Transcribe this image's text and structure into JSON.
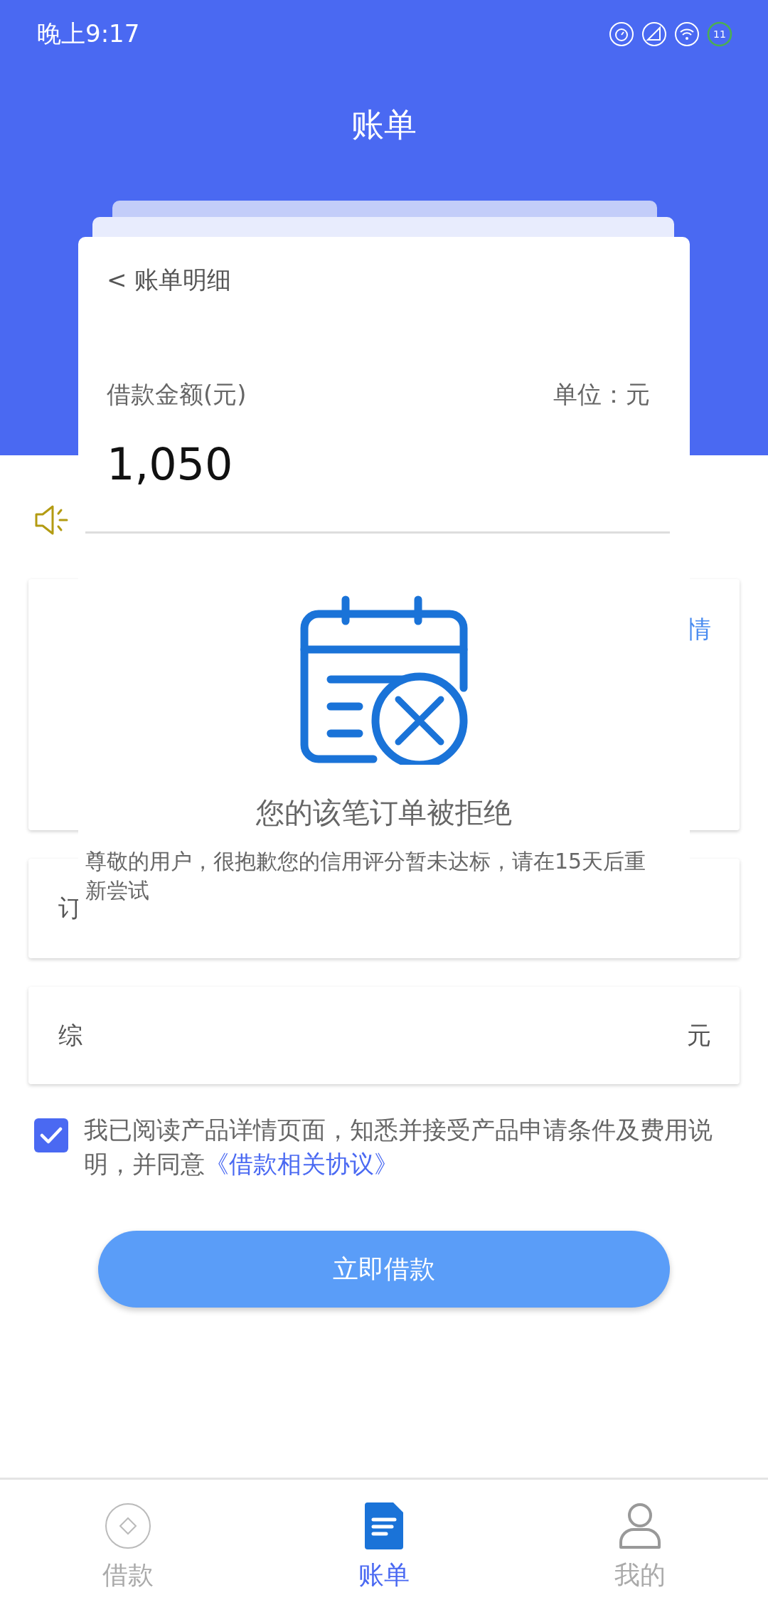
{
  "status_bar": {
    "time": "晚上9:17",
    "battery": "11"
  },
  "header": {
    "title": "账单"
  },
  "background_cards": [
    {
      "right": "情"
    },
    {
      "left": "订"
    },
    {
      "left": "综",
      "right": "元"
    }
  ],
  "dialog": {
    "back": "< 账单明细",
    "amount_label": "借款金额(元)",
    "unit": "单位：元",
    "amount": "1,050",
    "status_title": "您的该笔订单被拒绝",
    "message": "尊敬的用户，很抱歉您的信用评分暂未达标，请在15天后重新尝试"
  },
  "agreement": {
    "checked": true,
    "text": "我已阅读产品详情页面，知悉并接受产品申请条件及费用说明，并同意",
    "link": "《借款相关协议》"
  },
  "submit_button": "立即借款",
  "nav": [
    {
      "kind": "loan",
      "label": "借款",
      "selected": false
    },
    {
      "kind": "bill",
      "label": "账单",
      "selected": true
    },
    {
      "kind": "profile",
      "label": "我的",
      "selected": false
    }
  ]
}
